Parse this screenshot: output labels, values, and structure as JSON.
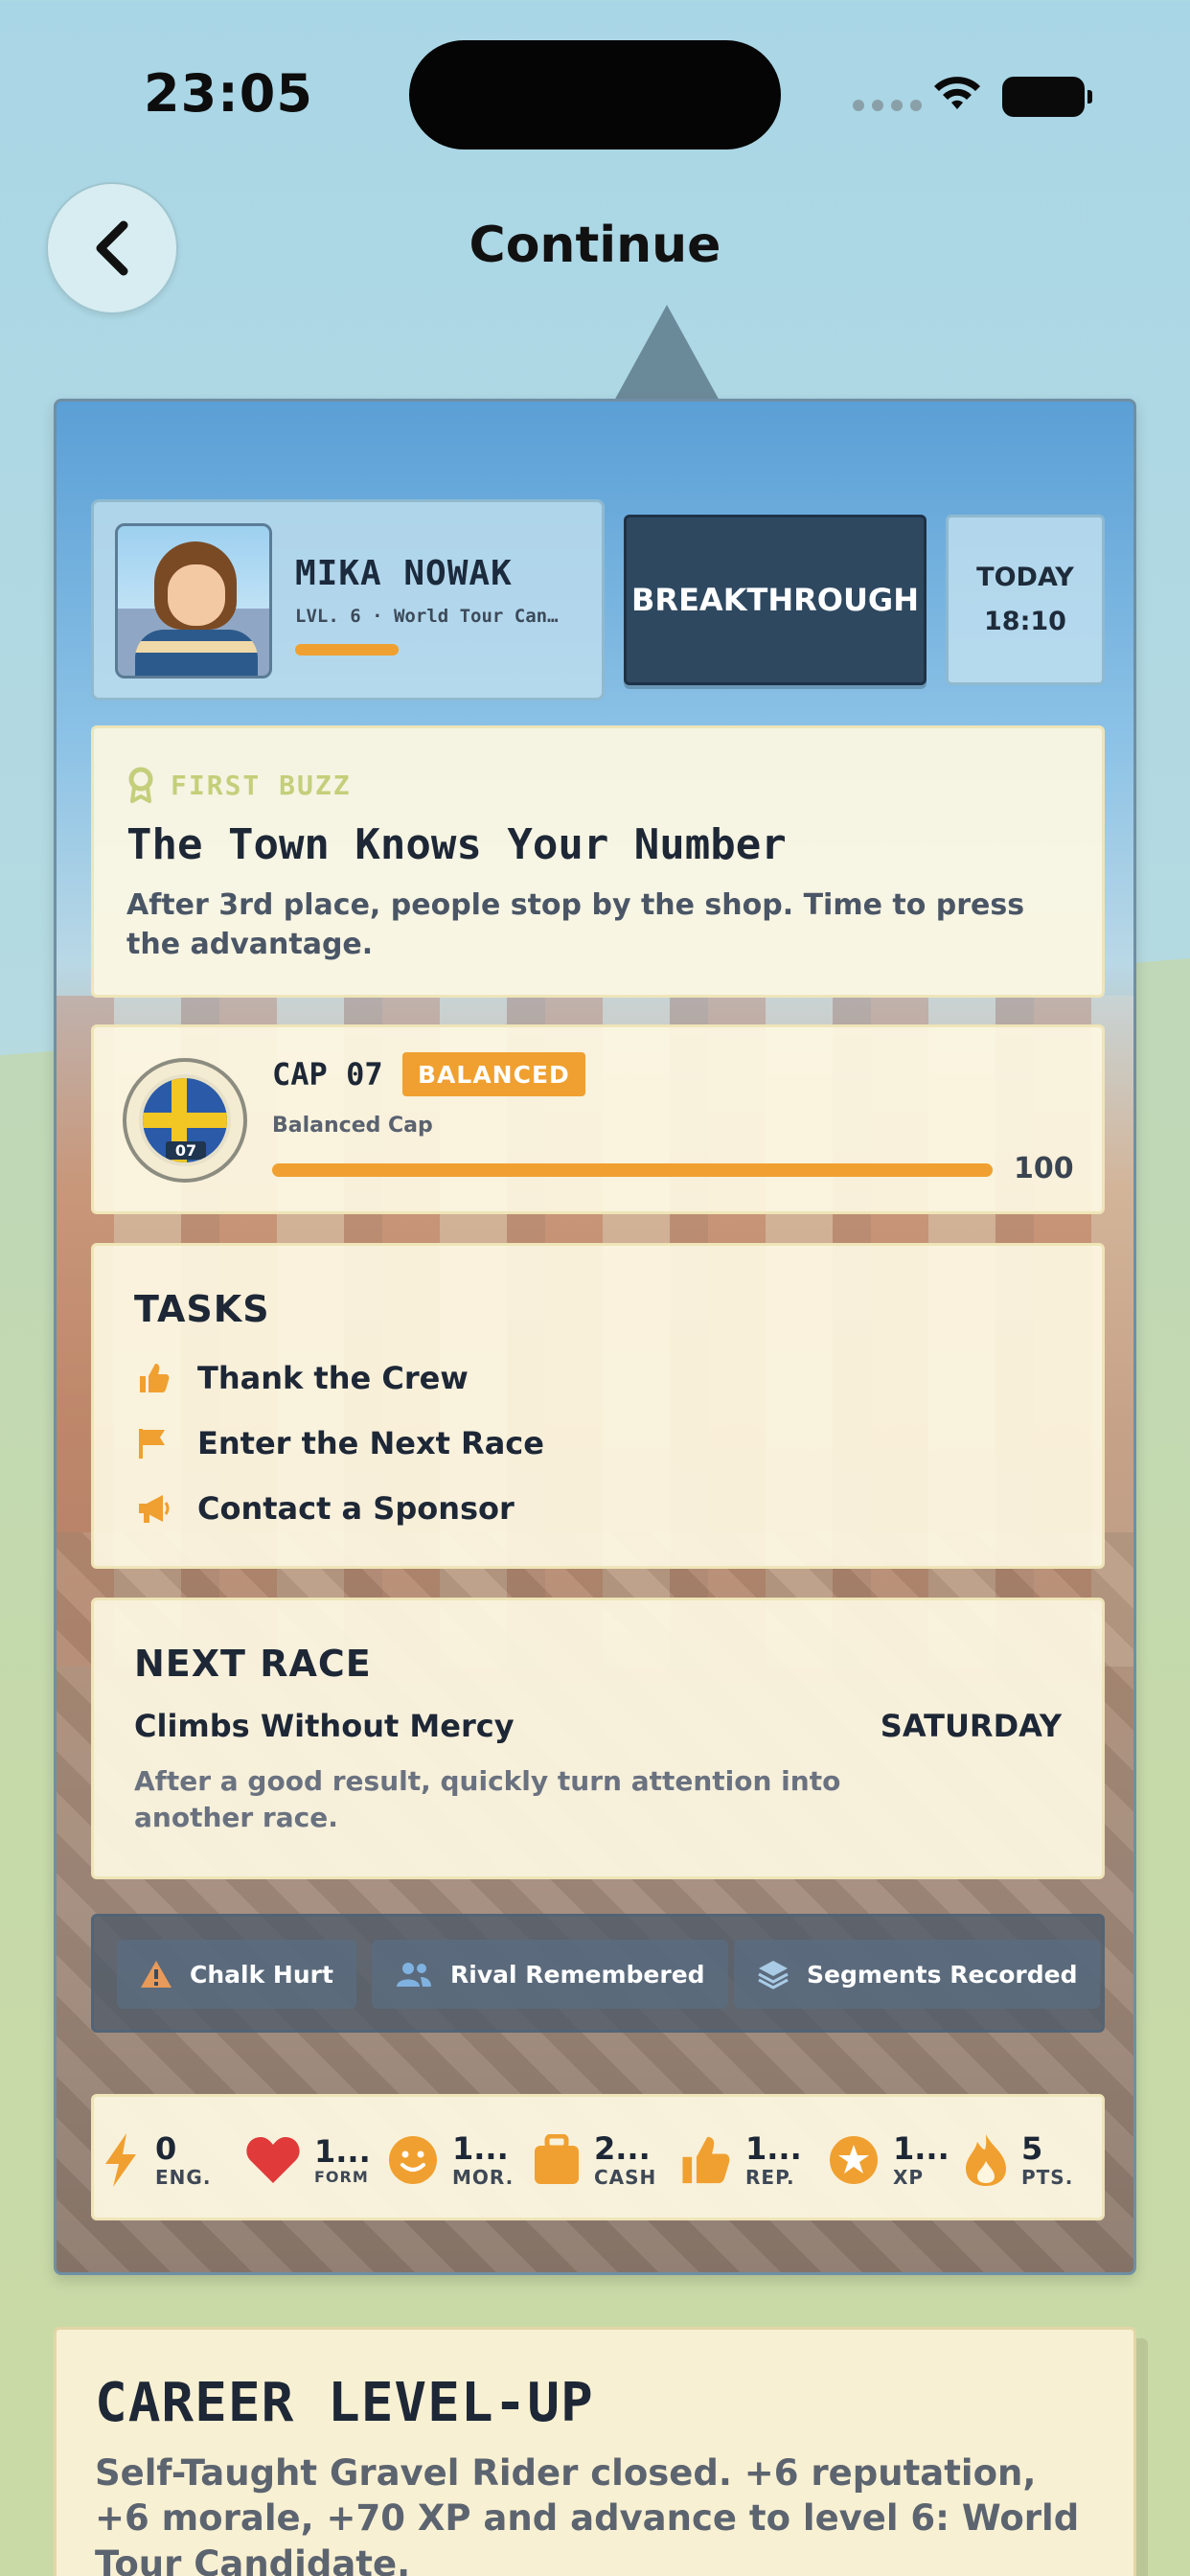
{
  "status_bar": {
    "time": "23:05"
  },
  "nav": {
    "title": "Continue"
  },
  "player": {
    "name": "MIKA NOWAK",
    "level": "LVL. 6 · World Tour Can…",
    "xp_progress": 0.36
  },
  "header_actions": {
    "breakthrough_label": "BREAKTHROUGH",
    "day": "TODAY",
    "time": "18:10"
  },
  "buzz": {
    "tag": "FIRST BUZZ",
    "title": "The Town Knows Your Number",
    "text": "After 3rd place, people stop by the shop. Time to press the advantage."
  },
  "cap": {
    "badge_number": "07",
    "title": "CAP 07",
    "tag": "BALANCED",
    "subtitle": "Balanced Cap",
    "value": "100",
    "progress": 1.0
  },
  "tasks": {
    "heading": "TASKS",
    "items": [
      {
        "icon": "thumbs-up-icon",
        "label": "Thank the Crew"
      },
      {
        "icon": "flag-icon",
        "label": "Enter the Next Race"
      },
      {
        "icon": "megaphone-icon",
        "label": "Contact a Sponsor"
      }
    ]
  },
  "next_race": {
    "heading": "NEXT RACE",
    "name": "Climbs Without Mercy",
    "day": "SATURDAY",
    "description": "After a good result, quickly turn attention into another race."
  },
  "chips": [
    {
      "icon": "warning-icon",
      "label": "Chalk Hurt"
    },
    {
      "icon": "users-icon",
      "label": "Rival Remembered"
    },
    {
      "icon": "layers-icon",
      "label": "Segments Recorded"
    }
  ],
  "stats": [
    {
      "icon": "lightning-icon",
      "value": "0",
      "label": "ENG."
    },
    {
      "icon": "heart-icon",
      "value": "1...",
      "label": "FORM"
    },
    {
      "icon": "smile-icon",
      "value": "1...",
      "label": "MOR."
    },
    {
      "icon": "briefcase-icon",
      "value": "2...",
      "label": "CASH"
    },
    {
      "icon": "thumbs-up-icon",
      "value": "1...",
      "label": "REP."
    },
    {
      "icon": "star-icon",
      "value": "1...",
      "label": "XP"
    },
    {
      "icon": "flame-icon",
      "value": "5",
      "label": "PTS."
    }
  ],
  "level_up": {
    "heading": "CAREER LEVEL-UP",
    "text": "Self-Taught Gravel Rider closed. +6 reputation, +6 morale, +70 XP and advance to level 6: World Tour Candidate."
  },
  "colors": {
    "accent": "#f0a030",
    "dark_button": "#2e4860",
    "panel": "#fdf8e2"
  }
}
